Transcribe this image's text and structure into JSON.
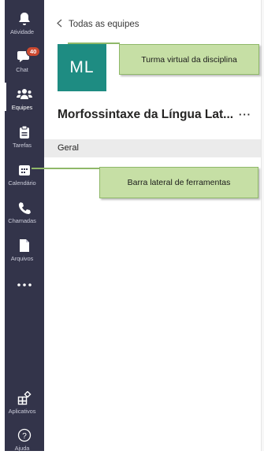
{
  "rail": {
    "items": [
      {
        "label": "Atividade",
        "icon": "bell-icon"
      },
      {
        "label": "Chat",
        "icon": "chat-icon",
        "badge": "40"
      },
      {
        "label": "Equipes",
        "icon": "teams-icon",
        "active": true
      },
      {
        "label": "Tarefas",
        "icon": "assignments-icon"
      },
      {
        "label": "Calendário",
        "icon": "calendar-icon"
      },
      {
        "label": "Chamadas",
        "icon": "phone-icon"
      },
      {
        "label": "Arquivos",
        "icon": "file-icon"
      },
      {
        "label": "",
        "icon": "more-icon"
      },
      {
        "label": "Aplicativos",
        "icon": "apps-icon"
      },
      {
        "label": "Ajuda",
        "icon": "help-icon"
      }
    ]
  },
  "header": {
    "back_label": "Todas as equipes"
  },
  "team": {
    "initials": "ML",
    "name": "Morfossintaxe da Língua Lat..."
  },
  "channel": {
    "name": "Geral"
  },
  "annotations": {
    "team_callout": "Turma virtual da disciplina",
    "rail_callout": "Barra lateral de ferramentas"
  },
  "colors": {
    "rail": "#33344a",
    "avatar": "#1e8c82",
    "callout": "#c6dfa5",
    "badge": "#cc4a31"
  }
}
